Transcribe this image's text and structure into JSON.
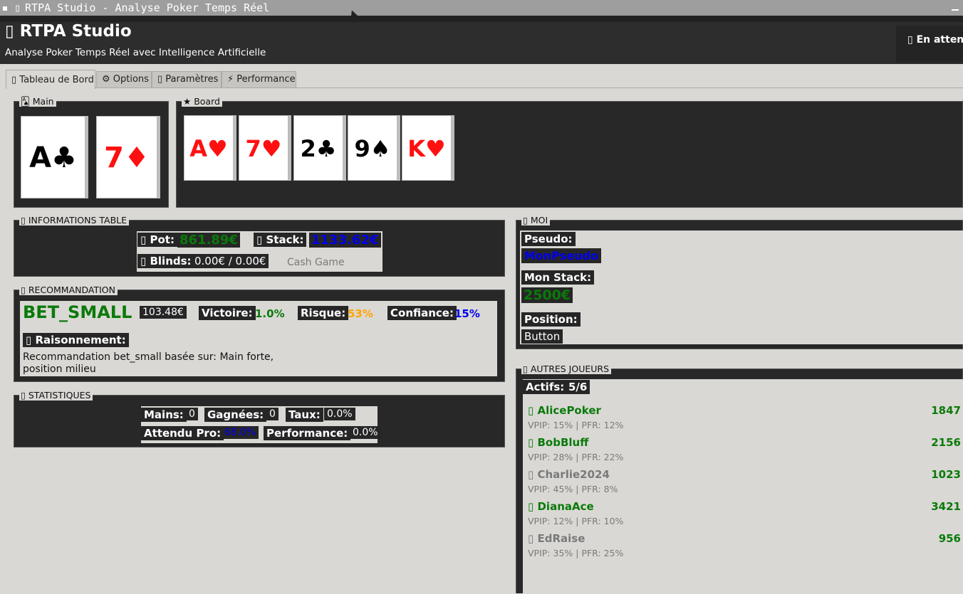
{
  "window": {
    "title": "RTPA Studio - Analyse Poker Temps Réel",
    "icon": "app-icon"
  },
  "header": {
    "title": "RTPA Studio",
    "subtitle": "Analyse Poker Temps Réel avec Intelligence Artificielle",
    "status": "En attent"
  },
  "tabs": [
    {
      "label": "Tableau de Bord",
      "icon": "dashboard-icon"
    },
    {
      "label": "⚙ Options",
      "icon": "gear-icon"
    },
    {
      "label": "Paramètres",
      "icon": "settings-icon"
    },
    {
      "label": "⚡ Performance",
      "icon": "lightning-icon"
    }
  ],
  "hand": {
    "title": "Main",
    "cards": [
      {
        "rank": "A",
        "suit": "♣",
        "color": "black"
      },
      {
        "rank": "7",
        "suit": "♦",
        "color": "red"
      }
    ]
  },
  "board": {
    "title": "Board",
    "cards": [
      {
        "rank": "A",
        "suit": "♥",
        "color": "red"
      },
      {
        "rank": "7",
        "suit": "♥",
        "color": "red"
      },
      {
        "rank": "2",
        "suit": "♣",
        "color": "black"
      },
      {
        "rank": "9",
        "suit": "♠",
        "color": "black"
      },
      {
        "rank": "K",
        "suit": "♥",
        "color": "red"
      }
    ]
  },
  "table_info": {
    "title": "INFORMATIONS TABLE",
    "pot_label": "Pot:",
    "pot_value": "861.89€",
    "stack_label": "Stack:",
    "stack_value": "1133.62€",
    "blinds_label": "Blinds:",
    "blinds_value": "0.00€ / 0.00€",
    "game_type": "Cash Game"
  },
  "recommendation": {
    "title": "RECOMMANDATION",
    "action": "BET_SMALL",
    "amount": "103.48€",
    "victory_label": "Victoire:",
    "victory_value": "1.0%",
    "risk_label": "Risque:",
    "risk_value": "53%",
    "confidence_label": "Confiance:",
    "confidence_value": "15%",
    "reasoning_label": "Raisonnement:",
    "reasoning_line1": "Recommandation bet_small basée sur: Main forte,",
    "reasoning_line2": "position milieu"
  },
  "stats": {
    "title": "STATISTIQUES",
    "hands_label": "Mains:",
    "hands_value": "0",
    "won_label": "Gagnées:",
    "won_value": "0",
    "rate_label": "Taux:",
    "rate_value": "0.0%",
    "expected_label": "Attendu Pro:",
    "expected_value": "68.0%",
    "perf_label": "Performance:",
    "perf_value": "0.0%"
  },
  "me": {
    "title": "MOI",
    "pseudo_label": "Pseudo:",
    "pseudo_value": "MonPseudo",
    "stack_label": "Mon Stack:",
    "stack_value": "2500€",
    "position_label": "Position:",
    "position_value": "Button"
  },
  "others": {
    "title": "AUTRES JOUEURS",
    "active_label": "Actifs:",
    "active_value": "5/6",
    "players": [
      {
        "name": "AlicePoker",
        "stack": "1847",
        "stats": "VPIP: 15% | PFR: 12%",
        "status": "active"
      },
      {
        "name": "BobBluff",
        "stack": "2156",
        "stats": "VPIP: 28% | PFR: 22%",
        "status": "active"
      },
      {
        "name": "Charlie2024",
        "stack": "1023",
        "stats": "VPIP: 45% | PFR: 8%",
        "status": "inactive"
      },
      {
        "name": "DianaAce",
        "stack": "3421",
        "stats": "VPIP: 12% | PFR: 10%",
        "status": "active"
      },
      {
        "name": "EdRaise",
        "stack": "956",
        "stats": "VPIP: 35% | PFR: 25%",
        "status": "active"
      }
    ]
  },
  "colors": {
    "green": "#0a7a0a",
    "blue": "#0000ee",
    "orange": "#ffa500",
    "grey": "#7a7a7a",
    "dark_panel": "#282828"
  }
}
